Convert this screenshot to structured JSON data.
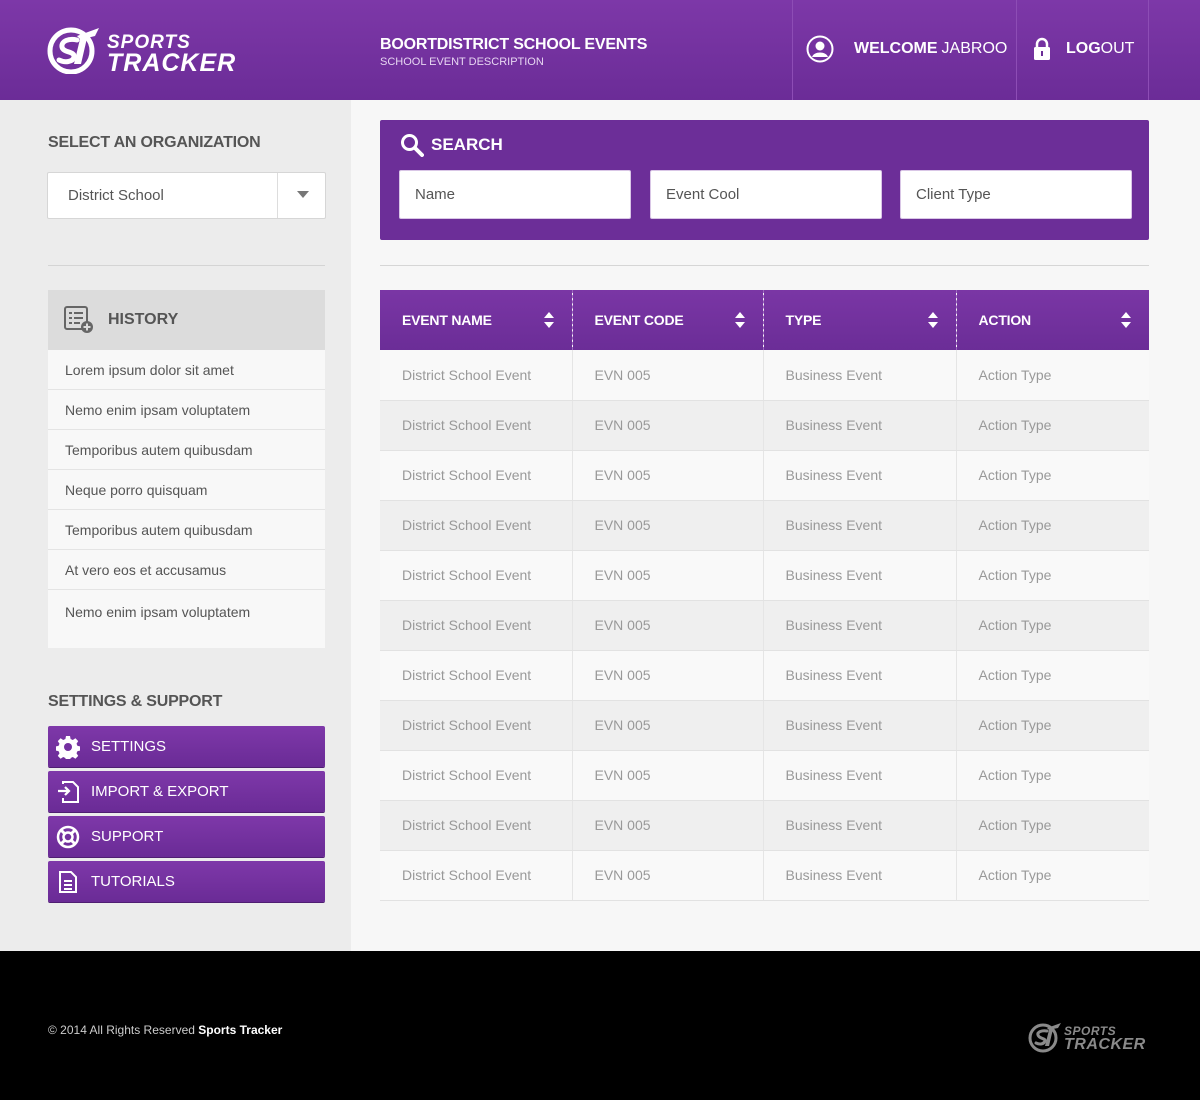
{
  "brand": {
    "line1": "SPORTS",
    "line2": "TRACKER",
    "logo_icon": "sports-tracker-logo"
  },
  "header": {
    "title": "BOORTDISTRICT SCHOOL EVENTS",
    "subtitle": "SCHOOL EVENT DESCRIPTION",
    "welcome_label": "WELCOME",
    "user_name": "JABROO",
    "logout_bold": "LOG",
    "logout_rest": "OUT",
    "user_icon": "user-icon",
    "lock_icon": "lock-icon"
  },
  "sidebar": {
    "org_title": "SELECT AN ORGANIZATION",
    "org_selected": "District School",
    "history_title": "HISTORY",
    "history_items": [
      "Lorem ipsum dolor sit amet",
      "Nemo enim ipsam voluptatem",
      "Temporibus autem quibusdam",
      "Neque porro quisquam",
      "Temporibus autem quibusdam",
      "At vero eos et accusamus",
      "Nemo enim ipsam voluptatem"
    ],
    "settings_title": "SETTINGS & SUPPORT",
    "settings_buttons": [
      {
        "label": "SETTINGS",
        "icon": "gear-icon"
      },
      {
        "label": "IMPORT & EXPORT",
        "icon": "import-export-icon"
      },
      {
        "label": "SUPPORT",
        "icon": "lifebuoy-icon"
      },
      {
        "label": "TUTORIALS",
        "icon": "document-icon"
      }
    ]
  },
  "search": {
    "title": "SEARCH",
    "fields": [
      {
        "placeholder": "Name"
      },
      {
        "placeholder": "Event Cool"
      },
      {
        "placeholder": "Client Type"
      }
    ]
  },
  "table": {
    "columns": [
      "EVENT NAME",
      "EVENT CODE",
      "TYPE",
      "ACTION"
    ],
    "rows": [
      [
        "District School Event",
        "EVN 005",
        "Business Event",
        "Action Type"
      ],
      [
        "District School Event",
        "EVN 005",
        "Business Event",
        "Action Type"
      ],
      [
        "District School Event",
        "EVN 005",
        "Business Event",
        "Action Type"
      ],
      [
        "District School Event",
        "EVN 005",
        "Business Event",
        "Action Type"
      ],
      [
        "District School Event",
        "EVN 005",
        "Business Event",
        "Action Type"
      ],
      [
        "District School Event",
        "EVN 005",
        "Business Event",
        "Action Type"
      ],
      [
        "District School Event",
        "EVN 005",
        "Business Event",
        "Action Type"
      ],
      [
        "District School Event",
        "EVN 005",
        "Business Event",
        "Action Type"
      ],
      [
        "District School Event",
        "EVN 005",
        "Business Event",
        "Action Type"
      ],
      [
        "District School Event",
        "EVN 005",
        "Business Event",
        "Action Type"
      ],
      [
        "District School Event",
        "EVN 005",
        "Business Event",
        "Action Type"
      ]
    ]
  },
  "footer": {
    "copyright": "© 2014 All  Rights Reserved ",
    "brand": "Sports Tracker"
  },
  "colors": {
    "brand_purple": "#6c2e98",
    "header_purple": "#7d38a8",
    "footer_bg": "#000000"
  }
}
